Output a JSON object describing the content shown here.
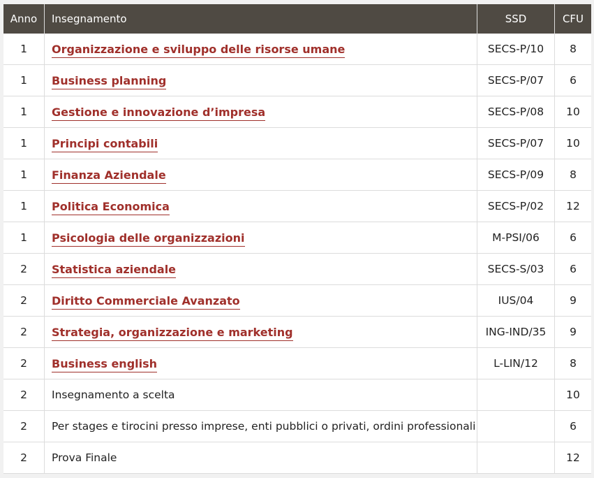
{
  "header": {
    "anno": "Anno",
    "insegnamento": "Insegnamento",
    "ssd": "SSD",
    "cfu": "CFU"
  },
  "rows": [
    {
      "anno": "1",
      "name": "Organizzazione e sviluppo delle risorse umane",
      "ssd": "SECS-P/10",
      "cfu": "8",
      "link": true
    },
    {
      "anno": "1",
      "name": "Business planning",
      "ssd": "SECS-P/07",
      "cfu": "6",
      "link": true
    },
    {
      "anno": "1",
      "name": "Gestione e innovazione d’impresa",
      "ssd": "SECS-P/08",
      "cfu": "10",
      "link": true
    },
    {
      "anno": "1",
      "name": "Principi contabili",
      "ssd": "SECS-P/07",
      "cfu": "10",
      "link": true
    },
    {
      "anno": "1",
      "name": "Finanza Aziendale",
      "ssd": "SECS-P/09",
      "cfu": "8",
      "link": true
    },
    {
      "anno": "1",
      "name": "Politica Economica",
      "ssd": "SECS-P/02",
      "cfu": "12",
      "link": true
    },
    {
      "anno": "1",
      "name": "Psicologia delle organizzazioni",
      "ssd": "M-PSI/06",
      "cfu": "6",
      "link": true
    },
    {
      "anno": "2",
      "name": "Statistica aziendale",
      "ssd": "SECS-S/03",
      "cfu": "6",
      "link": true
    },
    {
      "anno": "2",
      "name": "Diritto Commerciale Avanzato",
      "ssd": "IUS/04",
      "cfu": "9",
      "link": true
    },
    {
      "anno": "2",
      "name": "Strategia, organizzazione e marketing",
      "ssd": "ING-IND/35",
      "cfu": "9",
      "link": true
    },
    {
      "anno": "2",
      "name": "Business english",
      "ssd": "L-LIN/12",
      "cfu": "8",
      "link": true
    },
    {
      "anno": "2",
      "name": "Insegnamento a scelta",
      "ssd": "",
      "cfu": "10",
      "link": false
    },
    {
      "anno": "2",
      "name": "Per stages e tirocini presso imprese, enti pubblici o privati, ordini professionali",
      "ssd": "",
      "cfu": "6",
      "link": false
    },
    {
      "anno": "2",
      "name": "Prova Finale",
      "ssd": "",
      "cfu": "12",
      "link": false
    }
  ],
  "colors": {
    "header_bg": "#4f4a43",
    "link": "#a0302b"
  }
}
